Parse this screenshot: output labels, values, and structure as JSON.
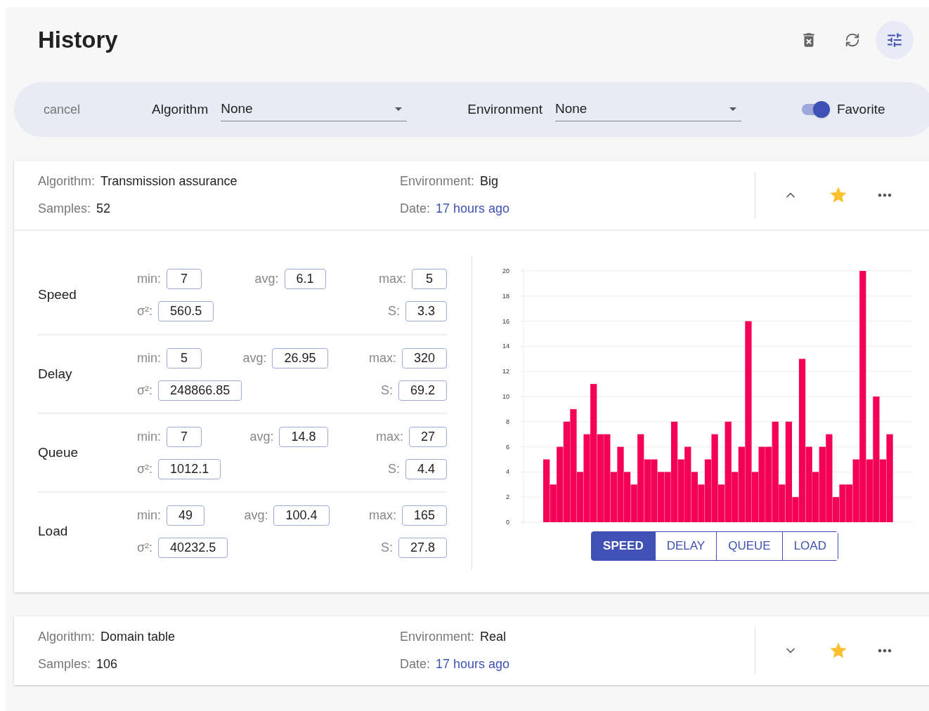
{
  "header": {
    "title": "History"
  },
  "filter_bar": {
    "cancel": "cancel",
    "algorithm": {
      "label": "Algorithm",
      "value": "None"
    },
    "environment": {
      "label": "Environment",
      "value": "None"
    },
    "favorite": {
      "label": "Favorite",
      "on": true
    }
  },
  "results": [
    {
      "algorithm": {
        "label": "Algorithm:",
        "value": "Transmission assurance"
      },
      "samples": {
        "label": "Samples:",
        "value": "52"
      },
      "environment": {
        "label": "Environment:",
        "value": "Big"
      },
      "date": {
        "label": "Date:",
        "value": "17 hours ago"
      },
      "expanded": true,
      "favorite": true,
      "details": {
        "metrics": [
          {
            "name": "Speed",
            "stats": [
              {
                "label": "min:",
                "value": "7"
              },
              {
                "label": "avg:",
                "value": "6.1"
              },
              {
                "label": "max:",
                "value": "5"
              },
              {
                "label": "σ²:",
                "value": "560.5"
              },
              {
                "label": "S:",
                "value": "3.3"
              }
            ]
          },
          {
            "name": "Delay",
            "stats": [
              {
                "label": "min:",
                "value": "5"
              },
              {
                "label": "avg:",
                "value": "26.95"
              },
              {
                "label": "max:",
                "value": "320"
              },
              {
                "label": "σ²:",
                "value": "248866.85"
              },
              {
                "label": "S:",
                "value": "69.2"
              }
            ]
          },
          {
            "name": "Queue",
            "stats": [
              {
                "label": "min:",
                "value": "7"
              },
              {
                "label": "avg:",
                "value": "14.8"
              },
              {
                "label": "max:",
                "value": "27"
              },
              {
                "label": "σ²:",
                "value": "1012.1"
              },
              {
                "label": "S:",
                "value": "4.4"
              }
            ]
          },
          {
            "name": "Load",
            "stats": [
              {
                "label": "min:",
                "value": "49"
              },
              {
                "label": "avg:",
                "value": "100.4"
              },
              {
                "label": "max:",
                "value": "165"
              },
              {
                "label": "σ²:",
                "value": "40232.5"
              },
              {
                "label": "S:",
                "value": "27.8"
              }
            ]
          }
        ],
        "chart_data": {
          "type": "bar",
          "grid": true,
          "series": [
            {
              "color": "#f50057",
              "values": [
                5,
                3,
                6,
                8,
                9,
                4,
                7,
                11,
                7,
                7,
                4,
                6,
                4,
                3,
                7,
                5,
                5,
                4,
                4,
                8,
                5,
                6,
                4,
                3,
                5,
                7,
                3,
                8,
                4,
                6,
                16,
                4,
                6,
                6,
                8,
                3,
                8,
                2,
                13,
                6,
                4,
                6,
                7,
                2,
                3,
                3,
                5,
                20,
                5,
                10,
                5,
                7
              ]
            }
          ],
          "ylim": [
            0,
            20
          ],
          "yticks": [
            0,
            2,
            4,
            6,
            8,
            10,
            12,
            14,
            16,
            18,
            20
          ]
        },
        "tabs": [
          {
            "label": "SPEED",
            "selected": true
          },
          {
            "label": "DELAY",
            "selected": false
          },
          {
            "label": "QUEUE",
            "selected": false
          },
          {
            "label": "LOAD",
            "selected": false
          }
        ]
      }
    },
    {
      "algorithm": {
        "label": "Algorithm:",
        "value": "Domain table"
      },
      "samples": {
        "label": "Samples:",
        "value": "106"
      },
      "environment": {
        "label": "Environment:",
        "value": "Real"
      },
      "date": {
        "label": "Date:",
        "value": "17 hours ago"
      },
      "expanded": false,
      "favorite": true
    }
  ]
}
